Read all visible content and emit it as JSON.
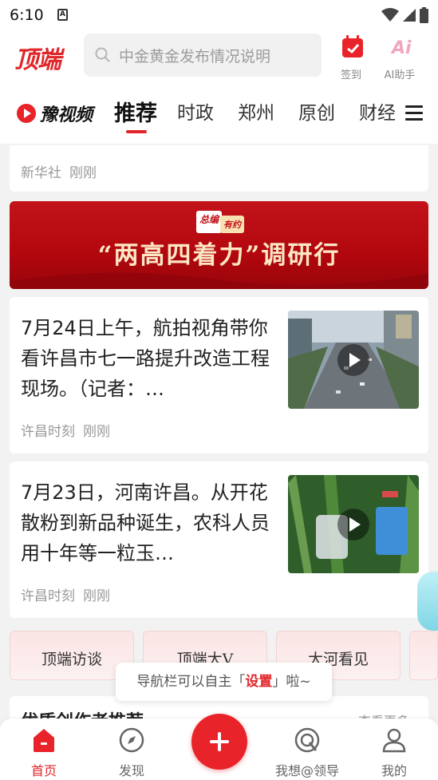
{
  "status": {
    "time": "6:10",
    "note_icon": "A"
  },
  "header": {
    "logo": "顶端",
    "search_placeholder": "中金黄金发布情况说明",
    "signin_label": "签到",
    "ai_label": "AI助手"
  },
  "tabs": {
    "brand": "豫视频",
    "items": [
      "推荐",
      "时政",
      "郑州",
      "原创",
      "财经"
    ],
    "active": "推荐"
  },
  "feed": {
    "top_card": {
      "source": "新华社",
      "time": "刚刚"
    },
    "banner": {
      "tag_a": "总编",
      "tag_b": "有约",
      "title": "“两高四着力”调研行"
    },
    "news": [
      {
        "text": "7月24日上午，航拍视角带你看许昌市七一路提升改造工程现场。（记者：…",
        "source": "许昌时刻",
        "time": "刚刚"
      },
      {
        "text": "7月23日，河南许昌。从开花散粉到新品种诞生，农科人员用十年等一粒玉…",
        "source": "许昌时刻",
        "time": "刚刚"
      }
    ]
  },
  "columns": [
    "顶端访谈",
    "顶端大V",
    "大河看见"
  ],
  "tooltip": {
    "before": "导航栏可以自主「",
    "highlight": "设置",
    "after": "」啦~"
  },
  "recommend": {
    "title": "优质创作者推荐",
    "more": "查看更多"
  },
  "bottom_nav": {
    "home": "首页",
    "discover": "发现",
    "ask": "我想@领导",
    "mine": "我的"
  },
  "colors": {
    "brand_red": "#e0262a"
  }
}
